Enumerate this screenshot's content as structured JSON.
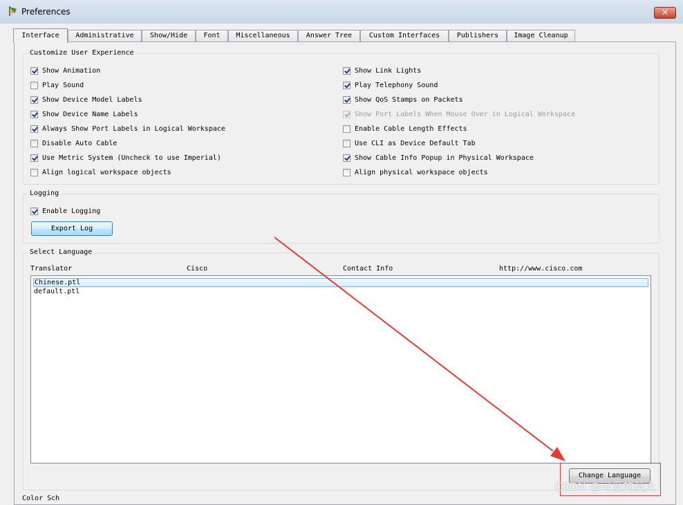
{
  "window": {
    "title": "Preferences",
    "close_glyph": "✕"
  },
  "tabs": [
    {
      "label": "Interface"
    },
    {
      "label": "Administrative"
    },
    {
      "label": "Show/Hide"
    },
    {
      "label": "Font"
    },
    {
      "label": "Miscellaneous"
    },
    {
      "label": "Answer Tree"
    },
    {
      "label": "Custom Interfaces"
    },
    {
      "label": "Publishers"
    },
    {
      "label": "Image Cleanup"
    }
  ],
  "customize": {
    "title": "Customize User Experience",
    "left": [
      {
        "label": "Show Animation",
        "checked": true
      },
      {
        "label": "Play Sound",
        "checked": false
      },
      {
        "label": "Show Device Model Labels",
        "checked": true
      },
      {
        "label": "Show Device Name Labels",
        "checked": true
      },
      {
        "label": "Always Show Port Labels in Logical Workspace",
        "checked": true
      },
      {
        "label": "Disable Auto Cable",
        "checked": false
      },
      {
        "label": "Use Metric System (Uncheck to use Imperial)",
        "checked": true
      },
      {
        "label": "Align logical workspace objects",
        "checked": false
      }
    ],
    "right": [
      {
        "label": "Show Link Lights",
        "checked": true
      },
      {
        "label": "Play Telephony Sound",
        "checked": true
      },
      {
        "label": "Show QoS Stamps on Packets",
        "checked": true
      },
      {
        "label": "Show Port Labels When Mouse Over in Logical Workspace",
        "checked": true,
        "disabled": true
      },
      {
        "label": "Enable Cable Length Effects",
        "checked": false
      },
      {
        "label": "Use CLI as Device Default Tab",
        "checked": false
      },
      {
        "label": "Show Cable Info Popup in Physical Workspace",
        "checked": true
      },
      {
        "label": "Align physical workspace objects",
        "checked": false
      }
    ]
  },
  "logging": {
    "title": "Logging",
    "enable_label": "Enable Logging",
    "enable_checked": true,
    "export_label": "Export Log"
  },
  "language": {
    "title": "Select Language",
    "headers": [
      "Translator",
      "Cisco",
      "Contact Info",
      "http://www.cisco.com"
    ],
    "items": [
      "Chinese.ptl",
      "default.ptl"
    ],
    "selected_index": 0,
    "change_label": "Change Language"
  },
  "footer": {
    "text": "Color Sch"
  },
  "watermark": "CSDN @可爱的莫大",
  "colors": {
    "annotation": "#e53935",
    "selection_border": "#84acdd"
  }
}
